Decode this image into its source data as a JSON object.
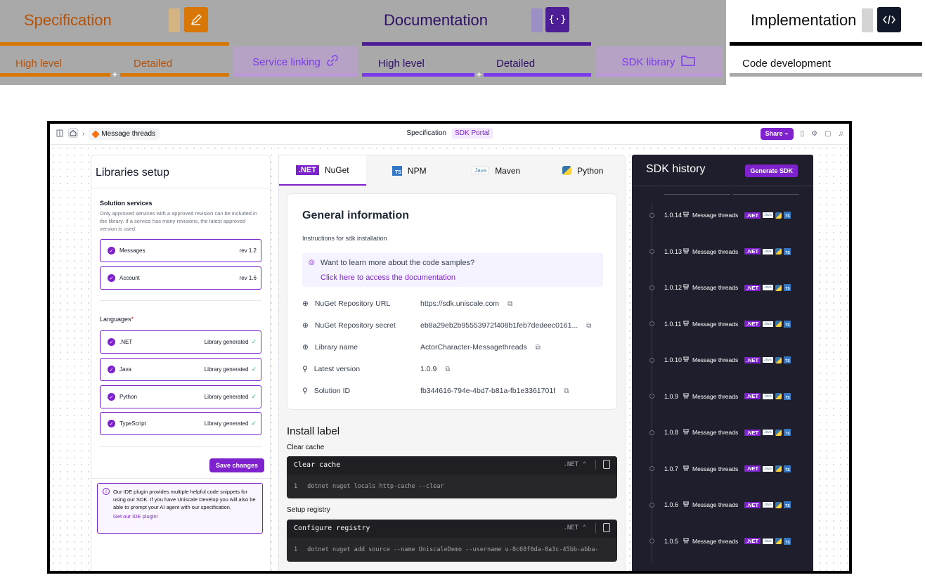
{
  "workflow": {
    "specification": {
      "title": "Specification",
      "high_level": "High level",
      "detailed": "Detailed",
      "color": "#d97706"
    },
    "service_linking": "Service linking",
    "documentation": {
      "title": "Documentation",
      "high_level": "High level",
      "detailed": "Detailed",
      "color": "#4c1d95"
    },
    "sdk_library": "SDK library",
    "implementation": {
      "title": "Implementation",
      "code_development": "Code development"
    },
    "plus": "+"
  },
  "appbar": {
    "breadcrumb": "Message threads",
    "center_left": "Specification",
    "center_right": "SDK Portal",
    "share": "Share"
  },
  "libraries": {
    "title": "Libraries setup",
    "solution_services_heading": "Solution services",
    "solution_services_desc": "Only approved services with a approved revision can be included in the library. If a service has many revisions, the latest approved version is used.",
    "services": [
      {
        "name": "Messages",
        "rev": "rev 1.2"
      },
      {
        "name": "Account",
        "rev": "rev 1.6"
      }
    ],
    "languages_heading": "Languages",
    "required_mark": "*",
    "languages": [
      {
        "name": ".NET",
        "status": "Library generated"
      },
      {
        "name": "Java",
        "status": "Library generated"
      },
      {
        "name": "Python",
        "status": "Library generated"
      },
      {
        "name": "TypeScript",
        "status": "Library generated"
      }
    ],
    "save_button": "Save changes",
    "plugin_text": "Our IDE plugin provides multiple helpful code snippets for using our SDK. If you have Uniscale Develop you will also be able to prompt your AI agent with our specification.",
    "plugin_link": "Get our IDE plugin!"
  },
  "tabs": [
    {
      "badge": ".NET",
      "label": "NuGet"
    },
    {
      "badge": "TS",
      "label": "NPM"
    },
    {
      "badge": "Java",
      "label": "Maven"
    },
    {
      "badge": "",
      "label": "Python"
    }
  ],
  "general": {
    "title": "General information",
    "subtitle": "Instructions for sdk installation",
    "learn_question": "Want to learn more about the code samples?",
    "learn_link": "Click here to access the documentation",
    "fields": [
      {
        "key": "NuGet Repository URL",
        "value": "https://sdk.uniscale.com"
      },
      {
        "key": "NuGet Repository secret",
        "value": "eb8a29eb2b95553972f408b1feb7dedeec0161..."
      },
      {
        "key": "Library name",
        "value": "ActorCharacter-Messagethreads"
      },
      {
        "key": "Latest version",
        "value": "1.0.9"
      },
      {
        "key": "Solution ID",
        "value": "fb344616-794e-4bd7-b81a-fb1e3361701f"
      }
    ]
  },
  "install": {
    "title": "Install label",
    "blocks": [
      {
        "caption": "Clear cache",
        "header": "Clear cache",
        "lang": ".NET",
        "line_no": "1",
        "code": "dotnet nuget locals http-cache --clear"
      },
      {
        "caption": "Setup registry",
        "header": "Configure registry",
        "lang": ".NET",
        "line_no": "1",
        "code": "dotnet nuget add source --name UniscaleDemo --username u-8c68f0da-8a3c-45bb-abba-"
      }
    ]
  },
  "history": {
    "title": "SDK history",
    "generate_button": "Generate SDK",
    "service_name": "Message threads",
    "net_badge": ".NET",
    "java_badge": "Java",
    "ts_badge": "TS",
    "versions": [
      "1.0.14",
      "1.0.13",
      "1.0.12",
      "1.0.11",
      "1.0.10",
      "1.0.9",
      "1.0.8",
      "1.0.7",
      "1.0.6",
      "1.0.5"
    ]
  }
}
